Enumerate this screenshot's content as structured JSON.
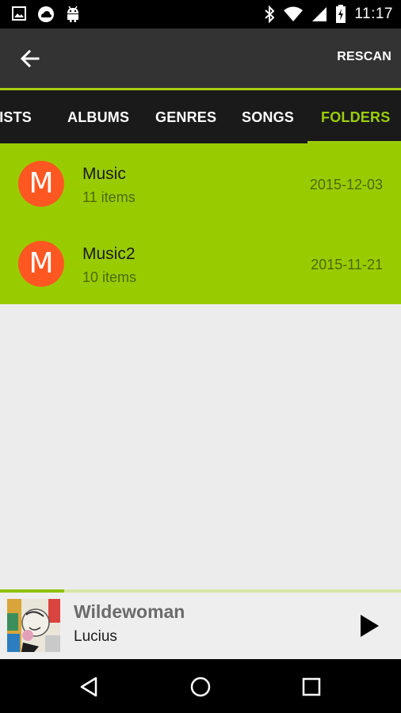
{
  "status_bar": {
    "time": "11:17",
    "left_icons": [
      "image-icon",
      "cloud-icon",
      "android-icon"
    ],
    "right_icons": [
      "bluetooth-icon",
      "wifi-icon",
      "signal-icon",
      "battery-charging-icon"
    ]
  },
  "action_bar": {
    "back_icon": "arrow-left-icon",
    "rescan_label": "RESCAN"
  },
  "tabs": [
    {
      "label": "TISTS",
      "active": false
    },
    {
      "label": "ALBUMS",
      "active": false
    },
    {
      "label": "GENRES",
      "active": false
    },
    {
      "label": "SONGS",
      "active": false
    },
    {
      "label": "FOLDERS",
      "active": true
    }
  ],
  "folders": [
    {
      "initial": "M",
      "name": "Music",
      "count": "11 items",
      "date": "2015-12-03"
    },
    {
      "initial": "M",
      "name": "Music2",
      "count": "10 items",
      "date": "2015-11-21"
    }
  ],
  "now_playing": {
    "title": "Wildewoman",
    "artist": "Lucius",
    "progress": 0.16,
    "play_icon": "play-icon"
  },
  "nav_bar": {
    "icons": [
      "back-triangle-icon",
      "home-circle-icon",
      "recents-square-icon"
    ]
  },
  "colors": {
    "accent": "#9ccd0c",
    "list_background": "#99cc00",
    "avatar": "#ff5722",
    "action_bar": "#333333",
    "tab_bar": "#1a1a1a"
  }
}
